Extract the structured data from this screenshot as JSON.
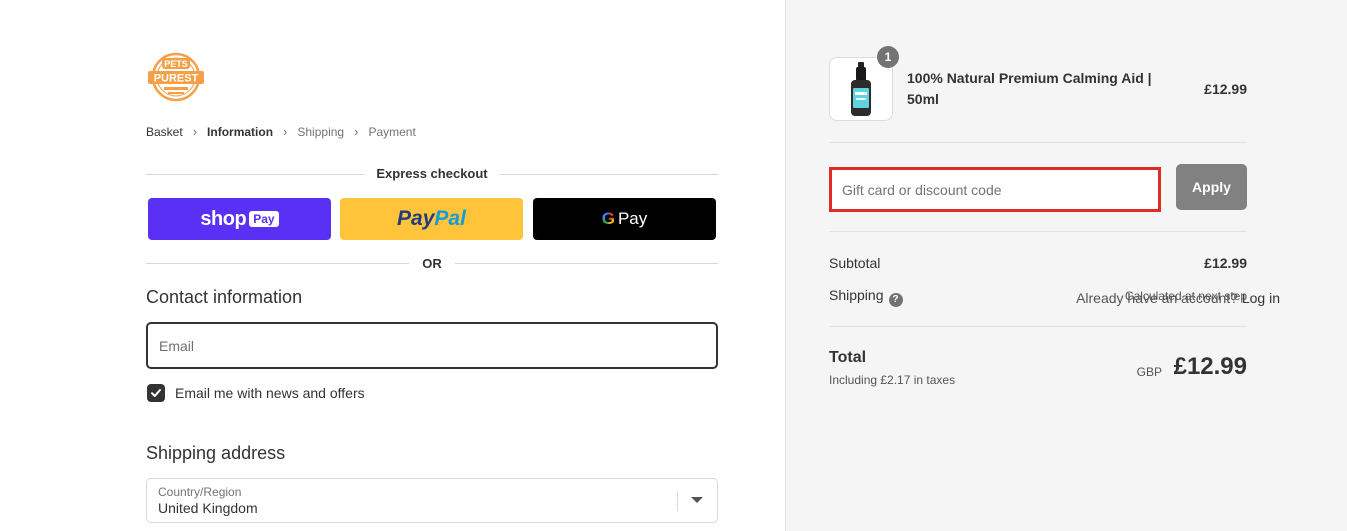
{
  "brand": {
    "logo_text_top": "PETS",
    "logo_text_main": "PUREST"
  },
  "breadcrumb": {
    "items": [
      "Basket",
      "Information",
      "Shipping",
      "Payment"
    ]
  },
  "express": {
    "title": "Express checkout",
    "shop_text": "shop",
    "shop_badge": "Pay",
    "paypal_pay": "Pay",
    "paypal_pal": "Pal",
    "gpay_g": "G",
    "gpay_text": "Pay",
    "colors": {
      "shop": "#5a31f4",
      "paypal": "#ffc439",
      "gpay": "#000000"
    }
  },
  "or_text": "OR",
  "contact": {
    "title": "Contact information",
    "account_prompt": "Already have an account?",
    "login_label": "Log in",
    "email_placeholder": "Email",
    "email_value": "",
    "newsletter_label": "Email me with news and offers",
    "newsletter_checked": true
  },
  "shipping_address": {
    "title": "Shipping address",
    "country_label": "Country/Region",
    "country_value": "United Kingdom"
  },
  "order": {
    "product_name": "100% Natural Premium Calming Aid | 50ml",
    "product_price": "£12.99",
    "quantity": "1",
    "discount_placeholder": "Gift card or discount code",
    "apply_label": "Apply",
    "subtotal_label": "Subtotal",
    "subtotal_value": "£12.99",
    "shipping_label": "Shipping",
    "shipping_value": "Calculated at next step",
    "total_label": "Total",
    "tax_note": "Including £2.17 in taxes",
    "currency": "GBP",
    "total_value": "£12.99"
  },
  "colors": {
    "accent_dark": "#333333",
    "highlight_red": "#e02b27",
    "logo_orange": "#f5a047"
  },
  "icons": [
    "chevron-right-icon",
    "check-icon",
    "chevron-down-icon",
    "help-icon"
  ]
}
